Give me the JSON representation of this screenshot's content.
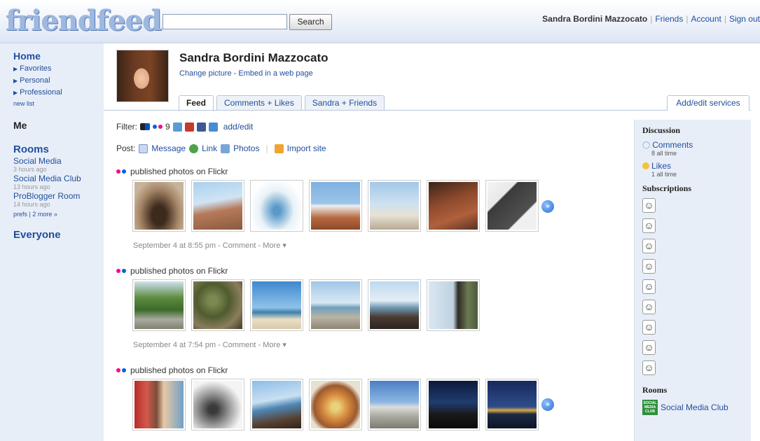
{
  "header": {
    "logo": "friendfeed",
    "search_placeholder": "",
    "search_button": "Search",
    "user_name": "Sandra Bordini Mazzocato",
    "nav": [
      "Friends",
      "Account",
      "Sign out"
    ]
  },
  "sidebar": {
    "home": "Home",
    "home_items": [
      "Favorites",
      "Personal",
      "Professional"
    ],
    "new_list": "new list",
    "me": "Me",
    "rooms": "Rooms",
    "room_items": [
      {
        "name": "Social Media",
        "time": "3 hours ago"
      },
      {
        "name": "Social Media Club",
        "time": "13 hours ago"
      },
      {
        "name": "ProBlogger Room",
        "time": "14 hours ago"
      }
    ],
    "prefs": "prefs | 2 more »",
    "everyone": "Everyone"
  },
  "profile": {
    "name": "Sandra Bordini Mazzocato",
    "links": "Change picture - Embed in a web page"
  },
  "tabs": [
    "Feed",
    "Comments + Likes",
    "Sandra + Friends"
  ],
  "add_edit_services": "Add/edit services",
  "filter": {
    "label": "Filter:",
    "count": "9",
    "add_edit": "add/edit"
  },
  "post": {
    "label": "Post:",
    "message": "Message",
    "link": "Link",
    "photos": "Photos",
    "import": "Import site"
  },
  "entries": [
    {
      "title": "published photos on Flickr",
      "meta": "September 4 at 8:55 pm - Comment - More ▾"
    },
    {
      "title": "published photos on Flickr",
      "meta": "September 4 at 7:54 pm - Comment - More ▾"
    },
    {
      "title": "published photos on Flickr",
      "meta": ""
    }
  ],
  "right": {
    "discussion": "Discussion",
    "comments": "Comments",
    "comments_count": "8 all time",
    "likes": "Likes",
    "likes_count": "1 all time",
    "subscriptions": "Subscriptions",
    "rooms": "Rooms",
    "room_name": "Social Media Club",
    "room_badge": "SOCIAL MEDIA CLUB"
  },
  "colors": {
    "link": "#1f4e9c",
    "sidebar_bg": "#e8eef8",
    "flickr_pink": "#ff0084",
    "flickr_blue": "#0063dc"
  }
}
